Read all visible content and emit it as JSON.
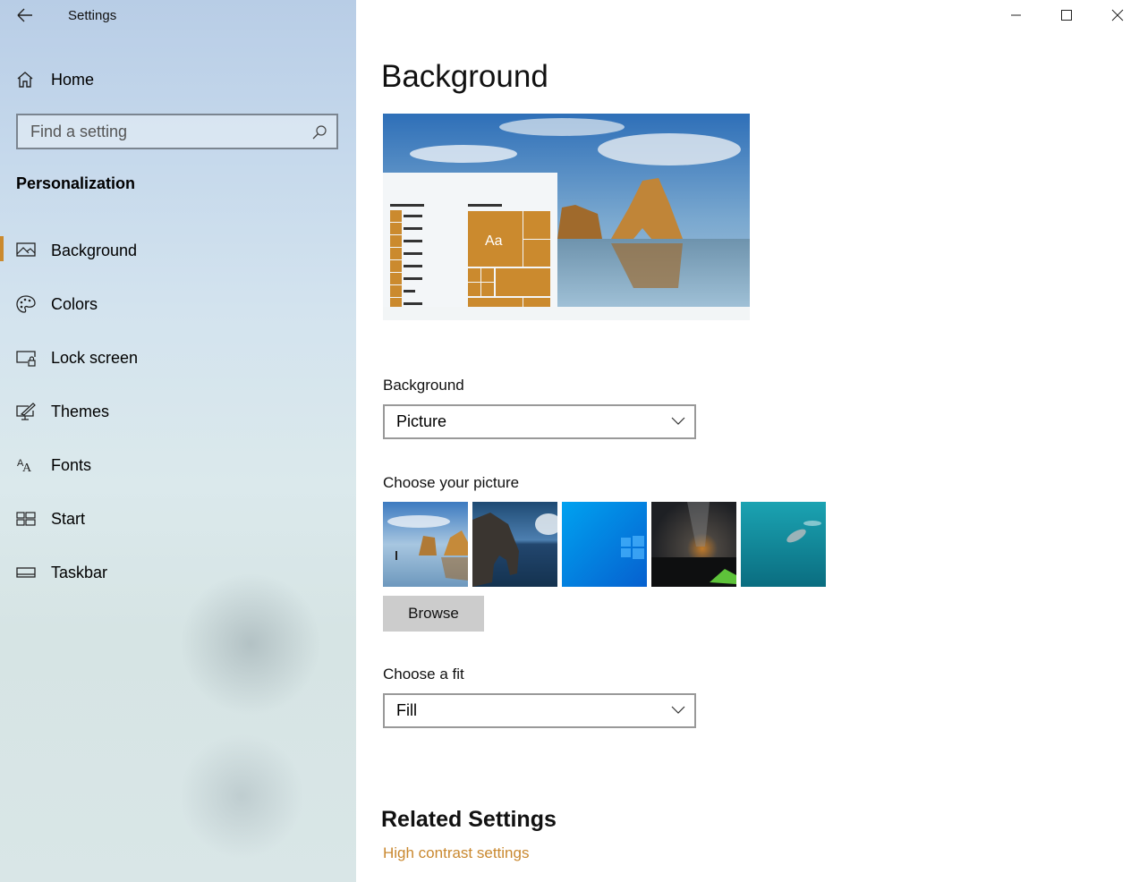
{
  "window": {
    "title": "Settings",
    "controls": {
      "minimize": "minimize-icon",
      "maximize": "maximize-icon",
      "close": "close-icon"
    }
  },
  "sidebar": {
    "home_label": "Home",
    "search": {
      "placeholder": "Find a setting",
      "value": ""
    },
    "section_title": "Personalization",
    "items": [
      {
        "label": "Background",
        "icon": "picture-icon",
        "active": true
      },
      {
        "label": "Colors",
        "icon": "palette-icon",
        "active": false
      },
      {
        "label": "Lock screen",
        "icon": "lock-screen-icon",
        "active": false
      },
      {
        "label": "Themes",
        "icon": "themes-icon",
        "active": false
      },
      {
        "label": "Fonts",
        "icon": "fonts-icon",
        "active": false
      },
      {
        "label": "Start",
        "icon": "start-icon",
        "active": false
      },
      {
        "label": "Taskbar",
        "icon": "taskbar-icon",
        "active": false
      }
    ]
  },
  "main": {
    "title": "Background",
    "preview": {
      "tile_text": "Aa"
    },
    "background_label": "Background",
    "background_value": "Picture",
    "choose_picture_label": "Choose your picture",
    "pictures": [
      {
        "name": "beach-rocks-runner"
      },
      {
        "name": "rock-arch-sea"
      },
      {
        "name": "windows-blue-logo"
      },
      {
        "name": "night-sky-tent"
      },
      {
        "name": "underwater-swimmer"
      }
    ],
    "browse_label": "Browse",
    "fit_label": "Choose a fit",
    "fit_value": "Fill",
    "related_title": "Related Settings",
    "related_links": [
      "High contrast settings"
    ]
  },
  "colors": {
    "accent": "#cb8a2e",
    "link": "#c9882f"
  }
}
